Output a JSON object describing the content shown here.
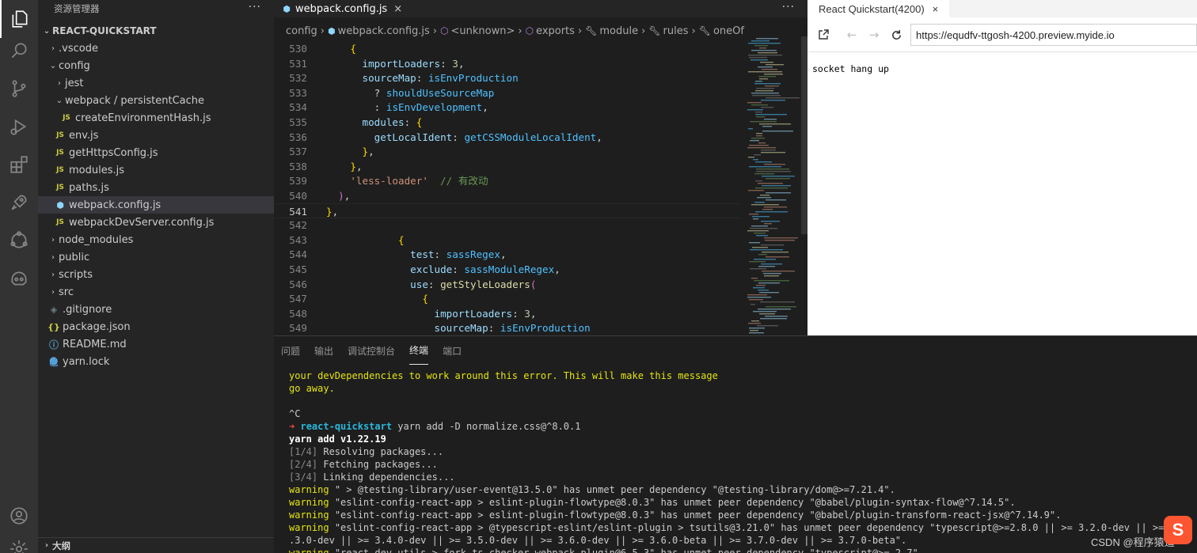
{
  "explorer": {
    "title": "资源管理器",
    "more": "···",
    "root": "REACT-QUICKSTART",
    "outline": "大纲",
    "items": [
      {
        "label": ".vscode",
        "type": "folder",
        "indent": 1
      },
      {
        "label": "config",
        "type": "folder-open",
        "indent": 1
      },
      {
        "label": "jest",
        "type": "folder",
        "indent": 2
      },
      {
        "label": "webpack / persistentCache",
        "type": "folder-open",
        "indent": 2
      },
      {
        "label": "createEnvironmentHash.js",
        "type": "js",
        "indent": 3
      },
      {
        "label": "env.js",
        "type": "js",
        "indent": 2
      },
      {
        "label": "getHttpsConfig.js",
        "type": "js",
        "indent": 2
      },
      {
        "label": "modules.js",
        "type": "js",
        "indent": 2
      },
      {
        "label": "paths.js",
        "type": "js",
        "indent": 2
      },
      {
        "label": "webpack.config.js",
        "type": "webpack",
        "indent": 2,
        "selected": true
      },
      {
        "label": "webpackDevServer.config.js",
        "type": "js",
        "indent": 2
      },
      {
        "label": "node_modules",
        "type": "folder",
        "indent": 1
      },
      {
        "label": "public",
        "type": "folder",
        "indent": 1
      },
      {
        "label": "scripts",
        "type": "folder",
        "indent": 1
      },
      {
        "label": "src",
        "type": "folder",
        "indent": 1
      },
      {
        "label": ".gitignore",
        "type": "git",
        "indent": 1
      },
      {
        "label": "package.json",
        "type": "json",
        "indent": 1
      },
      {
        "label": "README.md",
        "type": "info",
        "indent": 1
      },
      {
        "label": "yarn.lock",
        "type": "yarn",
        "indent": 1
      }
    ]
  },
  "editor": {
    "tab_label": "webpack.config.js",
    "tab_close": "×",
    "more": "···",
    "breadcrumb": [
      "config",
      "webpack.config.js",
      "<unknown>",
      "exports",
      "module",
      "rules",
      "oneOf"
    ],
    "current_line": 541,
    "lines": [
      {
        "n": 530,
        "code": "    {"
      },
      {
        "n": 531,
        "code": "      importLoaders: 3,"
      },
      {
        "n": 532,
        "code": "      sourceMap: isEnvProduction"
      },
      {
        "n": 533,
        "code": "        ? shouldUseSourceMap"
      },
      {
        "n": 534,
        "code": "        : isEnvDevelopment,"
      },
      {
        "n": 535,
        "code": "      modules: {"
      },
      {
        "n": 536,
        "code": "        getLocalIdent: getCSSModuleLocalIdent,"
      },
      {
        "n": 537,
        "code": "      },"
      },
      {
        "n": 538,
        "code": "    },"
      },
      {
        "n": 539,
        "code": "    'less-loader'  // 有改动"
      },
      {
        "n": 540,
        "code": "  ),"
      },
      {
        "n": 541,
        "code": "},"
      },
      {
        "n": 542,
        "code": ""
      },
      {
        "n": 543,
        "code": "            {"
      },
      {
        "n": 544,
        "code": "              test: sassRegex,"
      },
      {
        "n": 545,
        "code": "              exclude: sassModuleRegex,"
      },
      {
        "n": 546,
        "code": "              use: getStyleLoaders("
      },
      {
        "n": 547,
        "code": "                {"
      },
      {
        "n": 548,
        "code": "                  importLoaders: 3,"
      },
      {
        "n": 549,
        "code": "                  sourceMap: isEnvProduction"
      }
    ]
  },
  "browser": {
    "tab_label": "React Quickstart(4200)",
    "tab_close": "×",
    "url": "https://equdfv-ttgosh-4200.preview.myide.io",
    "body_text": "socket hang up"
  },
  "panel": {
    "tabs": [
      "问题",
      "输出",
      "调试控制台",
      "终端",
      "端口"
    ],
    "active_tab": "终端",
    "terminal": {
      "msg1": "your devDependencies to work around this error. This will make this message",
      "msg2": "go away.",
      "ctrl_c": "^C",
      "arrow": "➜",
      "prompt_dir": "react-quickstart",
      "command": "yarn add -D normalize.css@^8.0.1",
      "yarn_version": "yarn add v1.22.19",
      "steps": [
        {
          "tag": "[1/4]",
          "text": "Resolving packages..."
        },
        {
          "tag": "[2/4]",
          "text": "Fetching packages..."
        },
        {
          "tag": "[3/4]",
          "text": "Linking dependencies..."
        }
      ],
      "warnings": [
        {
          "tag": "warning",
          "text": "\" > @testing-library/user-event@13.5.0\" has unmet peer dependency \"@testing-library/dom@>=7.21.4\"."
        },
        {
          "tag": "warning",
          "text": "\"eslint-config-react-app > eslint-plugin-flowtype@8.0.3\" has unmet peer dependency \"@babel/plugin-syntax-flow@^7.14.5\"."
        },
        {
          "tag": "warning",
          "text": "\"eslint-config-react-app > eslint-plugin-flowtype@8.0.3\" has unmet peer dependency \"@babel/plugin-transform-react-jsx@^7.14.9\"."
        },
        {
          "tag": "warning",
          "text": "\"eslint-config-react-app > @typescript-eslint/eslint-plugin > tsutils@3.21.0\" has unmet peer dependency \"typescript@>=2.8.0 || >= 3.2.0-dev || >= 3.3.0-dev"
        },
        {
          "tag": "",
          "text": ".3.0-dev || >= 3.4.0-dev || >= 3.5.0-dev || >= 3.6.0-dev || >= 3.6.0-beta || >= 3.7.0-dev || >= 3.7.0-beta\"."
        },
        {
          "tag": "warning",
          "text": "\"react-dev-utils > fork-ts-checker-webpack-plugin@6.5.3\" has unmet peer dependency \"typescript@>= 2.7\"."
        }
      ]
    }
  },
  "watermark": {
    "text": "CSDN @程序猿追",
    "logo_char": "S"
  }
}
